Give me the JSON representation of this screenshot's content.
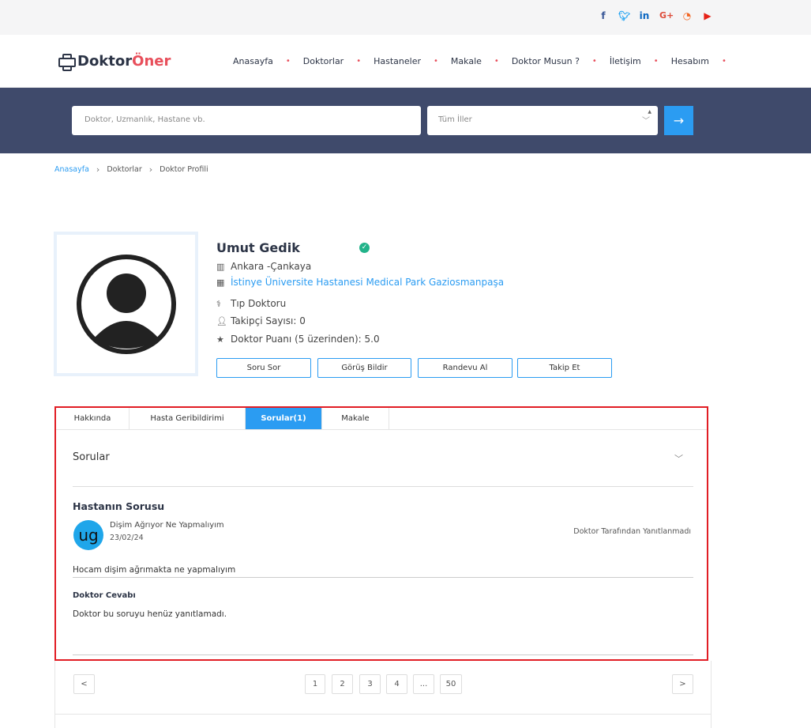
{
  "social": {
    "facebook": "f",
    "twitter": "t",
    "linkedin": "in",
    "googleplus": "G+",
    "rss": "rss",
    "youtube": "yt"
  },
  "brand": {
    "part1": "Doktor",
    "part2": "Öner",
    "accent": "#e84f5b",
    "dark": "#2c3446"
  },
  "nav": [
    "Anasayfa",
    "Doktorlar",
    "Hastaneler",
    "Makale",
    "Doktor Musun ?",
    "İletişim",
    "Hesabım"
  ],
  "search": {
    "placeholder": "Doktor, Uzmanlık, Hastane vb.",
    "city_selected": "Tüm İller",
    "submit_icon": "arrow-right-icon"
  },
  "breadcrumb": [
    "Anasayfa",
    "Doktorlar",
    "Doktor Profili"
  ],
  "profile": {
    "name": "Umut Gedik",
    "location": "Ankara -Çankaya",
    "hospital": "İstinye Üniversite Hastanesi Medical Park Gaziosmanpaşa",
    "specialty": "Tıp Doktoru",
    "followers": "Takipçi Sayısı: 0",
    "rating": "Doktor Puanı (5 üzerinden): 5.0"
  },
  "actions": [
    "Soru Sor",
    "Görüş Bildir",
    "Randevu Al",
    "Takip Et"
  ],
  "tabs": [
    "Hakkında",
    "Hasta Geribildirimi",
    "Sorular(1)",
    "Makale"
  ],
  "active_tab": 2,
  "questions": {
    "section_title": "Sorular",
    "item": {
      "title": "Hastanın Sorusu",
      "avatar_initials": "ug",
      "subject": "Dişim Ağrıyor Ne Yapmalıyım",
      "date": "23/02/24",
      "status": "Doktor Tarafından Yanıtlanmadı",
      "body": "Hocam dişim ağrımakta ne yapmalıyım",
      "answer_title": "Doktor Cevabı",
      "answer_body": "Doktor bu soruyu henüz yanıtlamadı."
    }
  },
  "pagination": {
    "prev": "<",
    "pages": [
      "1",
      "2",
      "3",
      "4",
      "...",
      "50"
    ],
    "next": ">"
  },
  "colors": {
    "primary": "#2b9cf2",
    "band": "#3f4a6b",
    "highlight_border": "#e11d24",
    "verified": "#22b38a"
  }
}
